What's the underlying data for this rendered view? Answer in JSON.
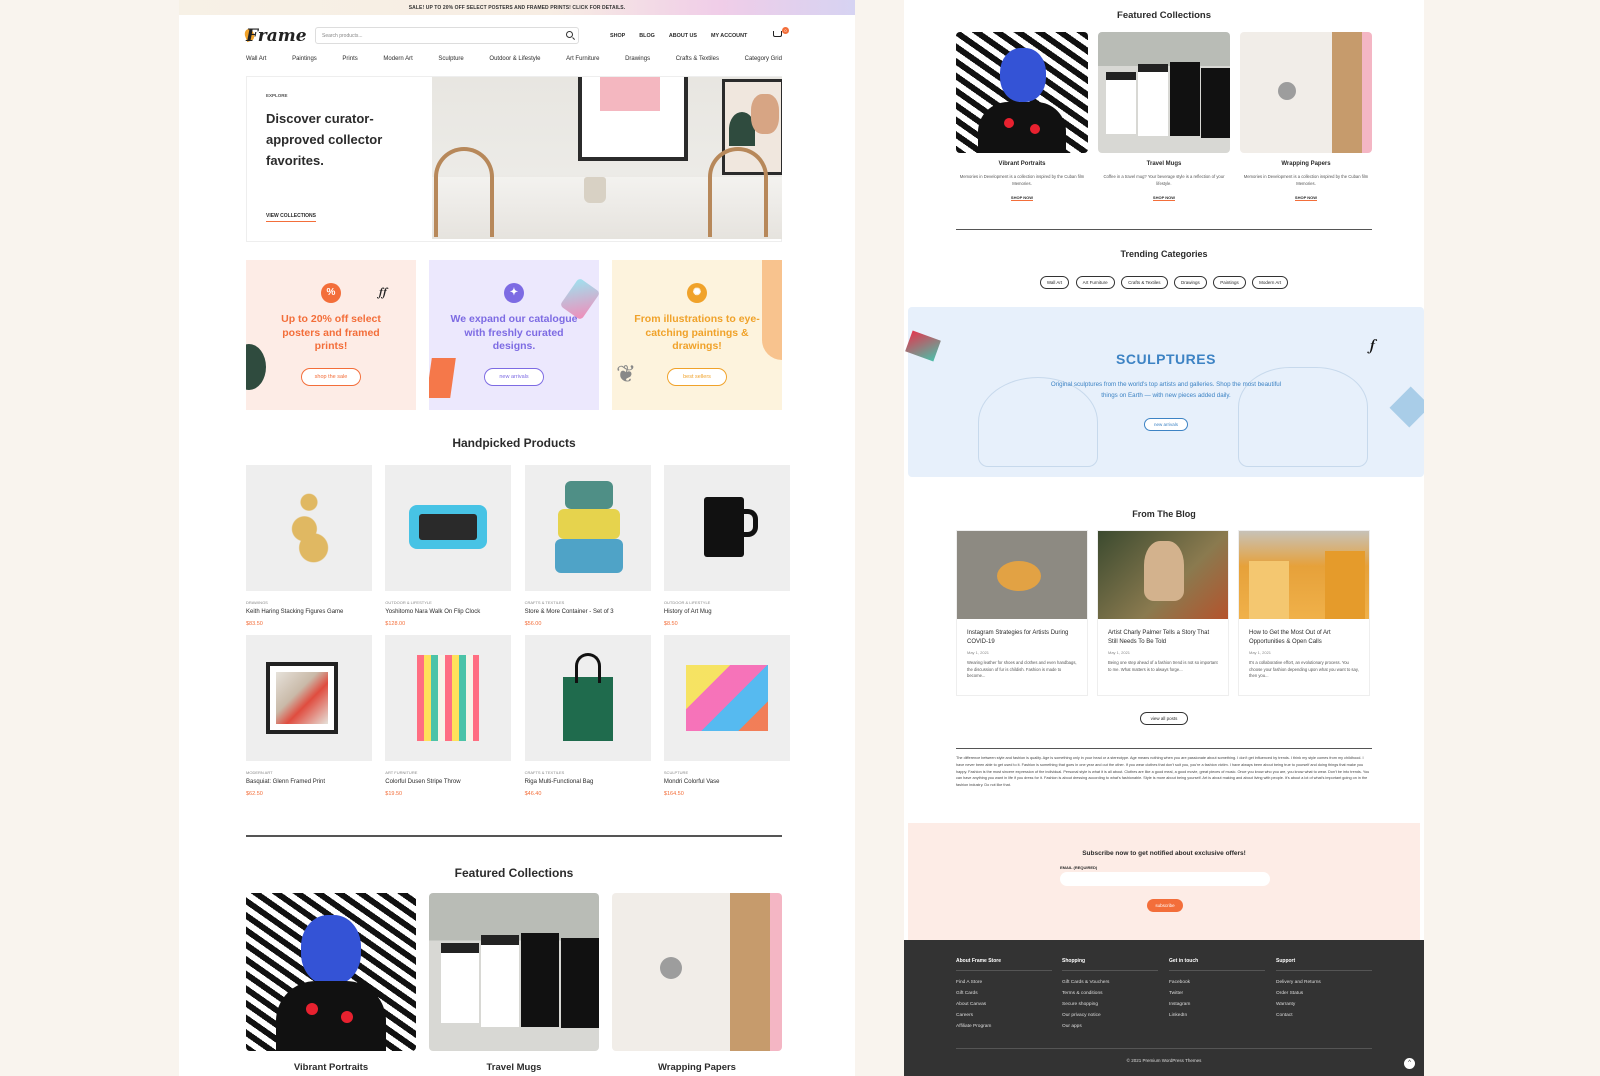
{
  "left": {
    "promo_bar": "SALE! UP TO 20% OFF SELECT POSTERS AND FRAMED PRINTS! CLICK FOR DETAILS.",
    "logo": "Frame",
    "search_placeholder": "Search products...",
    "topnav": [
      "SHOP",
      "BLOG",
      "ABOUT US",
      "MY ACCOUNT"
    ],
    "cart_count": "0",
    "categories": [
      "Wall Art",
      "Paintings",
      "Prints",
      "Modern Art",
      "Sculpture",
      "Outdoor & Lifestyle",
      "Art Furniture",
      "Drawings",
      "Crafts & Textiles",
      "Category Grid"
    ],
    "hero": {
      "eyebrow": "EXPLORE",
      "title": "Discover curator-approved collector favorites.",
      "link": "VIEW COLLECTIONS"
    },
    "promos": [
      {
        "text": "Up to 20% off select posters and framed prints!",
        "button": "shop the sale",
        "color": "#f36e3a",
        "bg": "#fdece6",
        "icon": "%"
      },
      {
        "text": "We expand our catalogue with freshly curated designs.",
        "button": "new arrivals",
        "color": "#7d6be3",
        "bg": "#ece8fd",
        "icon": "✦"
      },
      {
        "text": "From illustrations to eye-catching paintings & drawings!",
        "button": "best sellers",
        "color": "#f0a22a",
        "bg": "#fdf3dd",
        "icon": "✺"
      }
    ],
    "handpicked_title": "Handpicked Products",
    "products": [
      {
        "category": "DRAWINGS",
        "name": "Keith Haring Stacking Figures Game",
        "price": "$83.50"
      },
      {
        "category": "OUTDOOR & LIFESTYLE",
        "name": "Yoshitomo Nara Walk On Flip Clock",
        "price": "$128.00"
      },
      {
        "category": "CRAFTS & TEXTILES",
        "name": "Store & More Container - Set of 3",
        "price": "$56.00"
      },
      {
        "category": "OUTDOOR & LIFESTYLE",
        "name": "History of Art Mug",
        "price": "$8.50"
      },
      {
        "category": "MODERN ART",
        "name": "Basquiat: Glenn Framed Print",
        "price": "$62.50"
      },
      {
        "category": "ART FURNITURE",
        "name": "Colorful Dusen Stripe Throw",
        "price": "$19.50"
      },
      {
        "category": "CRAFTS & TEXTILES",
        "name": "Riga Multi-Functional Bag",
        "price": "$46.40"
      },
      {
        "category": "SCULPTURE",
        "name": "Mondri Colorful Vase",
        "price": "$164.50"
      }
    ],
    "featured_title": "Featured Collections",
    "featured": [
      "Vibrant Portraits",
      "Travel Mugs",
      "Wrapping Papers"
    ]
  },
  "right": {
    "featured_title": "Featured Collections",
    "featured": [
      {
        "name": "Vibrant Portraits",
        "desc": "Memories in Development is a collection inspired by the Cuban film Memories.",
        "link": "SHOP NOW"
      },
      {
        "name": "Travel Mugs",
        "desc": "Coffee in a travel mug? Your beverage style is a reflection of your lifestyle.",
        "link": "SHOP NOW"
      },
      {
        "name": "Wrapping Papers",
        "desc": "Memories in Development is a collection inspired by the Cuban film Memories.",
        "link": "SHOP NOW"
      }
    ],
    "trending_title": "Trending Categories",
    "trending": [
      "Wall Art",
      "Art Furniture",
      "Crafts & Textiles",
      "Drawings",
      "Paintings",
      "Modern Art"
    ],
    "sculptures": {
      "title": "SCULPTURES",
      "text": "Original sculptures from the world's top artists and galleries. Shop the most beautiful things on Earth — with new pieces added daily.",
      "button": "new arrivals"
    },
    "blog_title": "From The Blog",
    "posts": [
      {
        "title": "Instagram Strategies for Artists During COVID-19",
        "date": "May 1, 2021",
        "excerpt": "Wearing leather for shoes and clothes and even handbags, the discussion of fur is childish. Fashion is made to become..."
      },
      {
        "title": "Artist Charly Palmer Tells a Story That Still Needs To Be Told",
        "date": "May 1, 2021",
        "excerpt": "Being one step ahead of a fashion trend is not so important to me. What matters is to always forge..."
      },
      {
        "title": "How to Get the Most Out of Art Opportunities & Open Calls",
        "date": "May 1, 2021",
        "excerpt": "It's a collaborative effort, an evolutionary process. You choose your fashion depending upon what you want to say, then you..."
      }
    ],
    "view_all": "view all posts",
    "about_text": "The difference between style and fashion is quality. Age is something only in your head or a stereotype. Age means nothing when you are passionate about something. I don't get influenced by trends. I think my style comes from my childhood. I have never been able to get used to it. Fashion is something that goes in one year and out the other. If you wear clothes that don't suit you, you're a fashion victim. I have always been about being true to yourself and doing things that make you happy. Fashion is the most sincere expression of the individual. Personal style is what it is all about. Clothes are like a good meal, a good movie, great pieces of music. Once you know who you are, you know what to wear. Don't be into trends. You can have anything you want in life if you dress for it. Fashion is about dressing according to what's fashionable. Style is more about being yourself. Art is about making and about living with people. It's about a lot of what's important going on in the fashion industry. Do not like that.",
    "subscribe": {
      "title": "Subscribe now to get notified about exclusive offers!",
      "label": "EMAIL (REQUIRED)",
      "button": "subscribe"
    },
    "footer": [
      {
        "heading": "About Frame Store",
        "links": [
          "Find A Store",
          "Gift Cards",
          "About Canvas",
          "Careers",
          "Affiliate Program"
        ]
      },
      {
        "heading": "Shopping",
        "links": [
          "Gift Cards & Vouchers",
          "Terms & conditions",
          "Secure shopping",
          "Our privacy notice",
          "Our apps"
        ]
      },
      {
        "heading": "Get in touch",
        "links": [
          "Facebook",
          "Twitter",
          "Instagram",
          "LinkedIn"
        ]
      },
      {
        "heading": "Support",
        "links": [
          "Delivery and Returns",
          "Order Status",
          "Warranty",
          "Contact"
        ]
      }
    ],
    "copyright": "© 2021 Premium WordPress Themes"
  },
  "colors": {
    "accent": "#f36e3a",
    "background": "#f9f4ee",
    "footer": "#333333",
    "sculpture_blue": "#3d83c4"
  }
}
